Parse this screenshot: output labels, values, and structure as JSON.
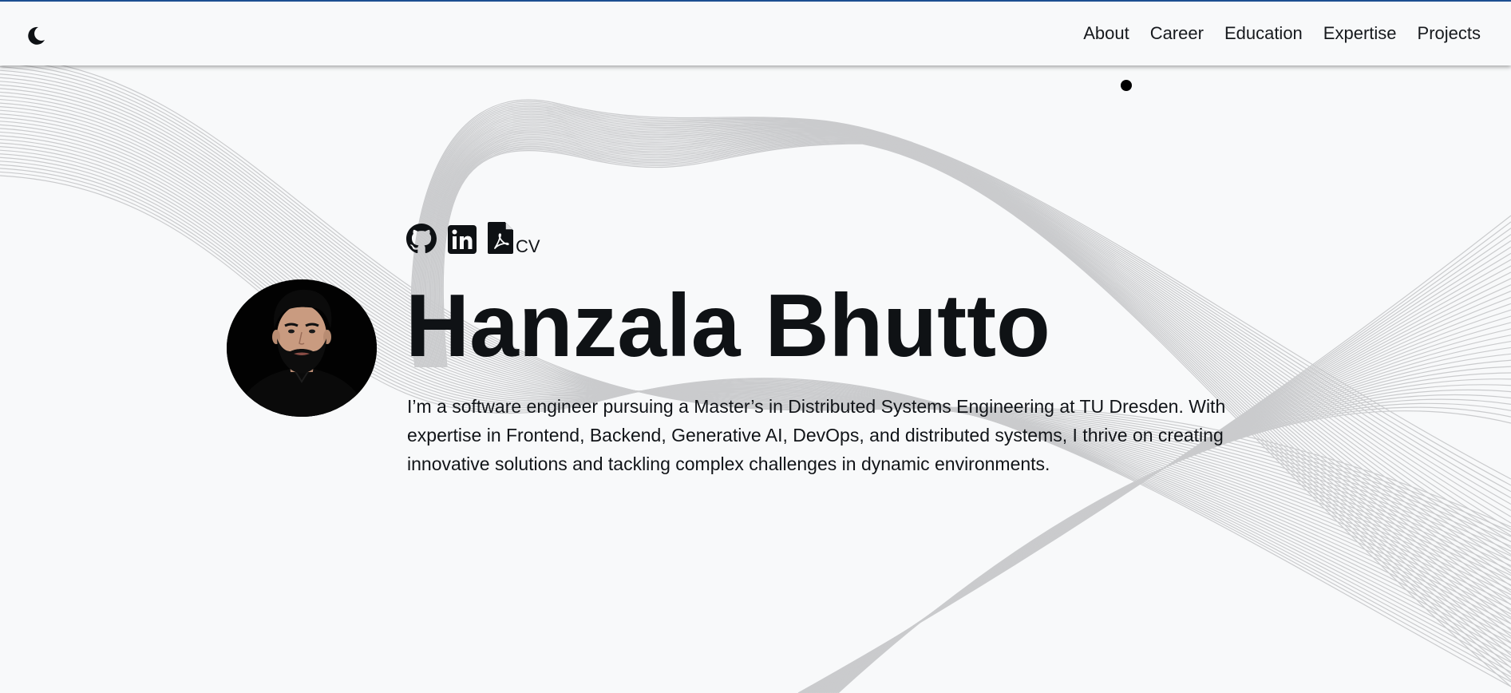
{
  "nav": {
    "theme_toggle_icon": "moon-icon",
    "links": [
      "About",
      "Career",
      "Education",
      "Expertise",
      "Projects"
    ]
  },
  "hero": {
    "social": {
      "github_icon": "github-icon",
      "linkedin_icon": "linkedin-icon",
      "cv_icon": "pdf-file-icon",
      "cv_label": "CV"
    },
    "avatar_alt": "profile-photo",
    "name": "Hanzala Bhutto",
    "bio": "I’m a software engineer pursuing a Master’s in Distributed Systems Engineering at TU Dresden. With expertise in Frontend, Backend, Generative AI, DevOps, and distributed systems, I thrive on creating innovative solutions and tackling complex challenges in dynamic environments."
  },
  "colors": {
    "background": "#f8f9fa",
    "top_accent": "#1c4f91",
    "text": "#111418",
    "wave_lines": "#c8c9cb"
  }
}
